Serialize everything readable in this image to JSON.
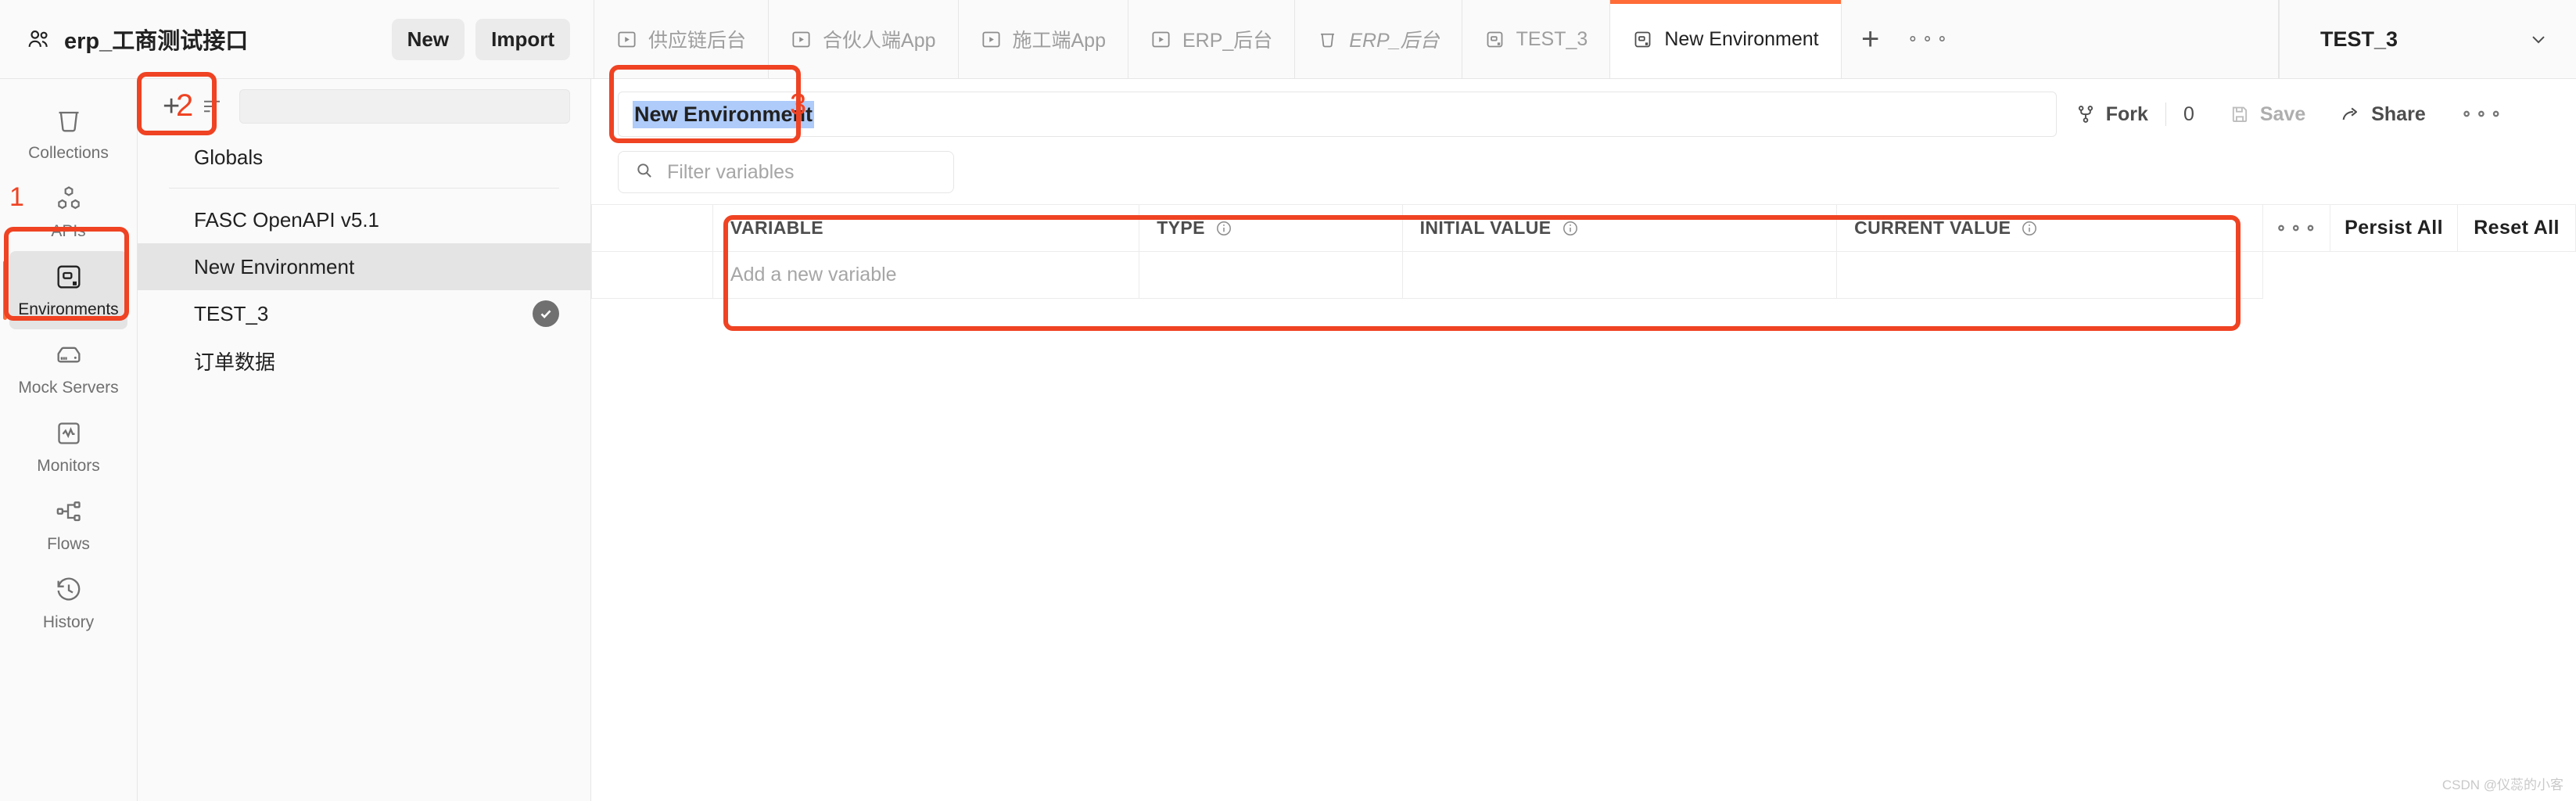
{
  "workspace": {
    "title": "erp_工商测试接口",
    "icon": "people-icon",
    "new_label": "New",
    "import_label": "Import"
  },
  "tabs": {
    "items": [
      {
        "label": "供应链后台",
        "icon": "request-icon",
        "active": false,
        "italic": false
      },
      {
        "label": "合伙人端App",
        "icon": "request-icon",
        "active": false,
        "italic": false
      },
      {
        "label": "施工端App",
        "icon": "request-icon",
        "active": false,
        "italic": false
      },
      {
        "label": "ERP_后台",
        "icon": "request-icon",
        "active": false,
        "italic": false
      },
      {
        "label": "ERP_后台",
        "icon": "collection-icon",
        "active": false,
        "italic": true
      },
      {
        "label": "TEST_3",
        "icon": "environment-icon",
        "active": false,
        "italic": false
      },
      {
        "label": "New Environment",
        "icon": "environment-icon",
        "active": true,
        "italic": false
      }
    ],
    "new_tab_icon": "plus-icon",
    "more_icon": "ellipsis-icon"
  },
  "environment_selector": {
    "value": "TEST_3",
    "chevron": "chevron-down-icon"
  },
  "sidebar": {
    "items": [
      {
        "label": "Collections",
        "icon": "collections-icon",
        "active": false
      },
      {
        "label": "APIs",
        "icon": "apis-icon",
        "active": false
      },
      {
        "label": "Environments",
        "icon": "environments-icon",
        "active": true
      },
      {
        "label": "Mock Servers",
        "icon": "mock-servers-icon",
        "active": false
      },
      {
        "label": "Monitors",
        "icon": "monitors-icon",
        "active": false
      },
      {
        "label": "Flows",
        "icon": "flows-icon",
        "active": false
      },
      {
        "label": "History",
        "icon": "history-icon",
        "active": false
      }
    ]
  },
  "env_pane": {
    "create_icon": "plus-icon",
    "sort_icon": "sort-icon",
    "globals_label": "Globals",
    "items": [
      {
        "name": "FASC OpenAPI v5.1",
        "selected": false,
        "active_check": false
      },
      {
        "name": "New Environment",
        "selected": true,
        "active_check": false
      },
      {
        "name": "TEST_3",
        "selected": false,
        "active_check": true
      },
      {
        "name": "订单数据",
        "selected": false,
        "active_check": false
      }
    ]
  },
  "editor": {
    "name_value": "New Environment",
    "fork_label": "Fork",
    "fork_count": "0",
    "save_label": "Save",
    "share_label": "Share",
    "more_icon": "ellipsis-icon",
    "fork_icon": "fork-icon",
    "save_icon": "save-icon",
    "share_icon": "share-icon"
  },
  "filter": {
    "placeholder": "Filter variables",
    "icon": "search-icon",
    "value": ""
  },
  "variables_table": {
    "columns": [
      {
        "key": "variable",
        "label": "VARIABLE",
        "info": false
      },
      {
        "key": "type",
        "label": "TYPE",
        "info": true
      },
      {
        "key": "initial",
        "label": "INITIAL VALUE",
        "info": true
      },
      {
        "key": "current",
        "label": "CURRENT VALUE",
        "info": true
      }
    ],
    "row_more_icon": "ellipsis-icon",
    "persist_all_label": "Persist All",
    "reset_all_label": "Reset All",
    "new_row_placeholder": "Add a new variable",
    "rows": []
  },
  "annotations": [
    {
      "num": "1"
    },
    {
      "num": "2"
    },
    {
      "num": "3"
    }
  ],
  "watermark": "CSDN @仪蕊的小客",
  "colors": {
    "accent": "#ff6c37",
    "annotation": "#ef4323",
    "selection": "#aecbfa"
  }
}
